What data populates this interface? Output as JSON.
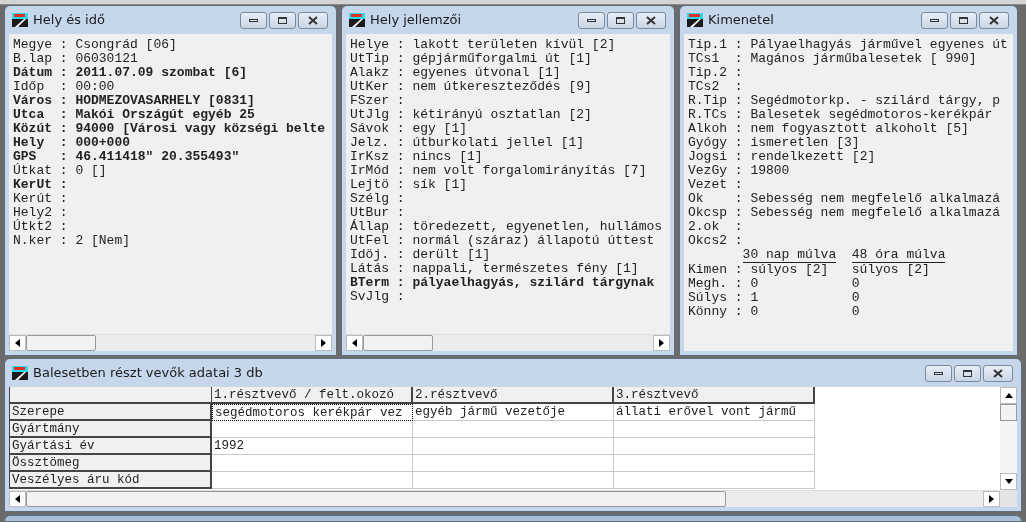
{
  "windows": [
    {
      "title": "Hely és idő",
      "lines": [
        {
          "text": "Megye : Csongrád [06]",
          "bold": false
        },
        {
          "text": "B.lap : 06030121",
          "bold": false
        },
        {
          "text": "Dátum : 2011.07.09 szombat [6]",
          "bold": true
        },
        {
          "text": "Időp  : 00:00",
          "bold": false
        },
        {
          "text": "Város : HODMEZOVASARHELY [0831]",
          "bold": true
        },
        {
          "text": "Utca  : Makói Országút egyéb 25",
          "bold": true
        },
        {
          "text": "Közút : 94000 [Városi vagy községi belte",
          "bold": true
        },
        {
          "text": "Hely  : 000+000",
          "bold": true
        },
        {
          "text": "GPS   : 46.411418\" 20.355493\"",
          "bold": true
        },
        {
          "text": "Útkat : 0 []",
          "bold": false
        },
        {
          "text": "KerUt :",
          "bold": true
        },
        {
          "text": "Kerút :",
          "bold": false
        },
        {
          "text": "Hely2 :",
          "bold": false
        },
        {
          "text": "Útkt2 :",
          "bold": false
        },
        {
          "text": "N.ker : 2 [Nem]",
          "bold": false
        }
      ]
    },
    {
      "title": "Hely jellemzői",
      "lines": [
        {
          "text": "Helye : lakott területen kívül [2]",
          "bold": false
        },
        {
          "text": "UtTip : gépjárműforgalmi út [1]",
          "bold": false
        },
        {
          "text": "Alakz : egyenes útvonal [1]",
          "bold": false
        },
        {
          "text": "UtKer : nem útkereszteződés [9]",
          "bold": false
        },
        {
          "text": "FSzer :",
          "bold": false
        },
        {
          "text": "UtJlg : kétirányú osztatlan [2]",
          "bold": false
        },
        {
          "text": "Sávok : egy [1]",
          "bold": false
        },
        {
          "text": "Jelz. : útburkolati jellel [1]",
          "bold": false
        },
        {
          "text": "IrKsz : nincs [1]",
          "bold": false
        },
        {
          "text": "IrMód : nem volt forgalomirányítás [7]",
          "bold": false
        },
        {
          "text": "Lejtö : sík [1]",
          "bold": false
        },
        {
          "text": "Szélg :",
          "bold": false
        },
        {
          "text": "UtBur :",
          "bold": false
        },
        {
          "text": "Állap : töredezett, egyenetlen, hullámos",
          "bold": false
        },
        {
          "text": "UtFel : normál (száraz) állapotú úttest",
          "bold": false
        },
        {
          "text": "Idöj. : derült [1]",
          "bold": false
        },
        {
          "text": "Látás : nappali, természetes fény [1]",
          "bold": false
        },
        {
          "text": "BTerm : pályaelhagyás, szilárd tárgynak",
          "bold": true
        },
        {
          "text": "SvJlg :",
          "bold": false
        }
      ]
    },
    {
      "title": "Kimenetel",
      "lines": [
        {
          "text": "Tip.1 : Pályaelhagyás járművel egyenes út",
          "bold": false
        },
        {
          "text": "TCs1  : Magános járműbalesetek [ 990]",
          "bold": false
        },
        {
          "text": "Tip.2 :",
          "bold": false
        },
        {
          "text": "TCs2  :",
          "bold": false
        },
        {
          "text": "R.Tip : Segédmotorkp. - szilárd tárgy, p",
          "bold": false
        },
        {
          "text": "R.TCs : Balesetek segédmotoros-kerékpár",
          "bold": false
        },
        {
          "text": "Alkoh : nem fogyasztott alkoholt [5]",
          "bold": false
        },
        {
          "text": "Gyógy : ismeretlen [3]",
          "bold": false
        },
        {
          "text": "Jogsi : rendelkezett [2]",
          "bold": false
        },
        {
          "text": "VezGy : 19800",
          "bold": false
        },
        {
          "text": "Vezet :",
          "bold": false
        },
        {
          "text": "Ok    : Sebesség nem megfelelő alkalmazá",
          "bold": false
        },
        {
          "text": "Okcsp : Sebesség nem megfelelő alkalmazá",
          "bold": false
        },
        {
          "text": "2.ok  :",
          "bold": false
        },
        {
          "text": "Okcs2 :",
          "bold": false
        }
      ],
      "outcome": {
        "columns": [
          "30 nap múlva",
          "48 óra múlva"
        ],
        "rows": [
          {
            "label": "Kimen :",
            "values": [
              "súlyos [2]",
              "súlyos [2]"
            ]
          },
          {
            "label": "Megh. :",
            "values": [
              "0",
              "0"
            ]
          },
          {
            "label": "Súlys :",
            "values": [
              "1",
              "0"
            ]
          },
          {
            "label": "Könny :",
            "values": [
              "0",
              "0"
            ]
          }
        ]
      }
    }
  ],
  "participants": {
    "title": "Balesetben részt vevők adatai 3 db",
    "columns": [
      "1.résztvevő / felt.okozó",
      "2.résztvevő",
      "3.résztvevő"
    ],
    "rows": [
      {
        "label": "Szerepe",
        "cells": [
          {
            "text": "segédmotoros kerékpár vez",
            "selected": true
          },
          {
            "text": "egyéb jármű vezetője",
            "selected": false
          },
          {
            "text": "állati erővel vont jármű",
            "selected": false
          }
        ]
      },
      {
        "label": "Gyártmány",
        "cells": [
          {
            "text": "",
            "selected": false
          },
          {
            "text": "",
            "selected": false
          },
          {
            "text": "",
            "selected": false
          }
        ]
      },
      {
        "label": "Gyártási év",
        "cells": [
          {
            "text": "1992",
            "selected": false
          },
          {
            "text": "",
            "selected": false
          },
          {
            "text": "",
            "selected": false
          }
        ]
      },
      {
        "label": "Össztömeg",
        "cells": [
          {
            "text": "",
            "selected": false
          },
          {
            "text": "",
            "selected": false
          },
          {
            "text": "",
            "selected": false
          }
        ]
      },
      {
        "label": "Veszélyes áru kód",
        "cells": [
          {
            "text": "",
            "selected": false
          },
          {
            "text": "",
            "selected": false
          },
          {
            "text": "",
            "selected": false
          }
        ]
      }
    ]
  }
}
